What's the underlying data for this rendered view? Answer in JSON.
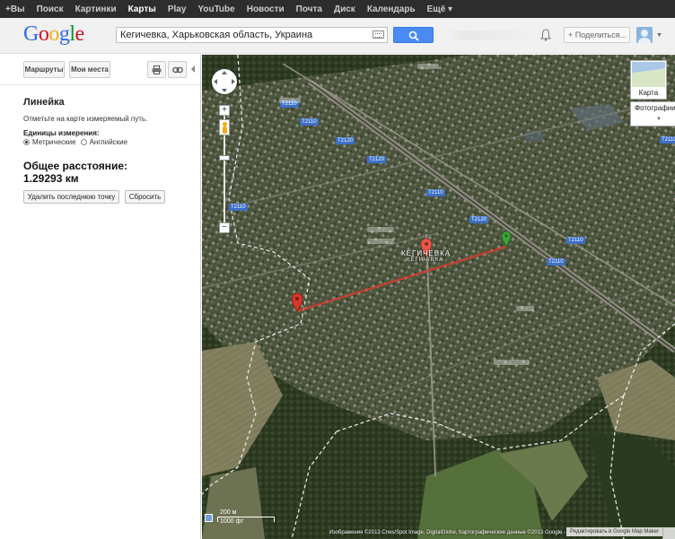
{
  "topbar": {
    "items": [
      {
        "label": "+Вы",
        "active": false
      },
      {
        "label": "Поиск",
        "active": false
      },
      {
        "label": "Картинки",
        "active": false
      },
      {
        "label": "Карты",
        "active": true
      },
      {
        "label": "Play",
        "active": false
      },
      {
        "label": "YouTube",
        "active": false
      },
      {
        "label": "Новости",
        "active": false
      },
      {
        "label": "Почта",
        "active": false
      },
      {
        "label": "Диск",
        "active": false
      },
      {
        "label": "Календарь",
        "active": false
      },
      {
        "label": "Ещё ▾",
        "active": false
      }
    ]
  },
  "header": {
    "logo": "Google",
    "search_value": "Кегичевка, Харьковская область, Украина",
    "share_label": "+ Поделиться..."
  },
  "panel": {
    "routes_label": "Маршруты",
    "my_places_label": "Мои места",
    "ruler_title": "Линейка",
    "ruler_hint": "Отметьте на карте измеряемый путь.",
    "units_label": "Единицы измерения:",
    "unit_metric": "Метрические",
    "unit_english": "Английские",
    "unit_selected": "metric",
    "total_label": "Общее расстояние:",
    "total_value": "1.29293 км",
    "undo_label": "Удалить последнюю точку",
    "reset_label": "Сбросить"
  },
  "map": {
    "maptype_label": "Карта",
    "layer_label": "Фотографии",
    "town_label": "КЕГИЧЕВКА",
    "town_sub": "КЕГИЧІВКА",
    "scale_top": "200 м",
    "scale_bottom": "1000 фт",
    "attribution": "Изображения ©2013 Cnes/Spot Image, DigitalGlobe, Картографические данные ©2013 Google -",
    "edit_link": "Редактировать в Google Map Maker",
    "roads": [
      "T2110",
      "T2110",
      "T2120",
      "T2110",
      "T2120",
      "T2120",
      "T2110",
      "T2110",
      "T2110",
      "T2120"
    ],
    "colors": {
      "ruler_line": "#e23a2e",
      "marker_red": "#d9362b",
      "marker_green": "#3ca33c",
      "road_badge": "#3d6fc6"
    }
  }
}
